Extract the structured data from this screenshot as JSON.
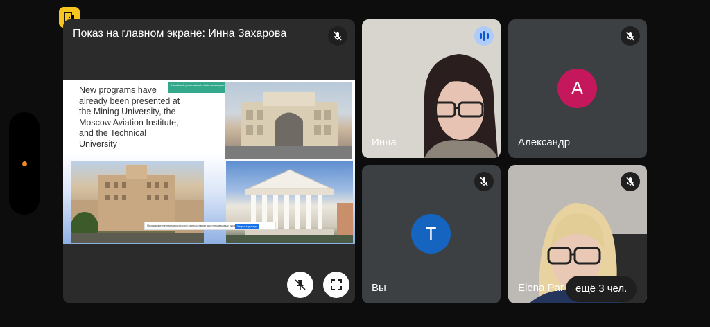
{
  "presentation": {
    "title": "Показ на главном экране: Инна Захарова",
    "slide": {
      "text": "New programs have already been presented at the Mining University, the Moscow Aviation Institute, and the Technical University",
      "notice_text": "Nanda.seb pnrax accanin fasta ucnosnyan.seb.syskarny",
      "cookie_text": "Прoнaкоменте наsa google.com предоставляe дocтуп к вашему экрану",
      "cookie_button": "Закрыть доступ",
      "cookie_link": "Скрыть"
    }
  },
  "participants": [
    {
      "name": "Инна",
      "state": "speaking"
    },
    {
      "name": "Александр",
      "initial": "А",
      "avatar_color": "#c5175c",
      "state": "muted"
    },
    {
      "name": "Вы",
      "initial": "Т",
      "avatar_color": "#1565c0",
      "state": "muted"
    },
    {
      "name": "Elena Par",
      "state": "muted"
    }
  ],
  "more_participants": "ещё 3 чел.",
  "colors": {
    "background": "#0d0d0d",
    "tile": "#3c4043",
    "exit_badge": "#f7c51f"
  }
}
